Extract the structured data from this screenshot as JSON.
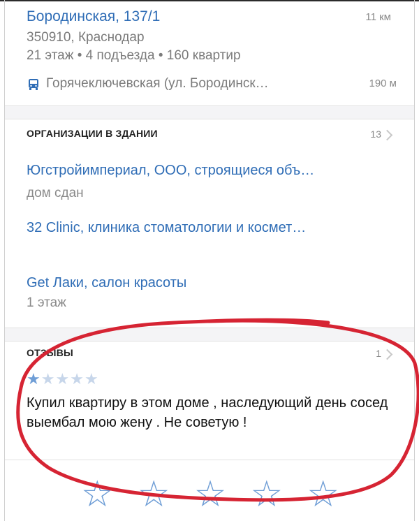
{
  "address": {
    "title": "Бородинская, 137/1",
    "distance": "11 км",
    "postal": "350910, Краснодар",
    "details": "21 этаж • 4 подъезда • 160 квартир",
    "stop": "Горячеключевская (ул. Бородинск…",
    "stop_distance": "190 м",
    "stop_icon": "bus-icon"
  },
  "organizations": {
    "header": "ОРГАНИЗАЦИИ В ЗДАНИИ",
    "count": "13",
    "items": [
      {
        "name": "Югстройимпериал, ООО, строящиеся объ…",
        "sub": "дом сдан"
      },
      {
        "name": "32 Clinic, клиника стоматологии и космет…",
        "sub": ""
      },
      {
        "name": "Get Лаки, салон красоты",
        "sub": "1 этаж"
      }
    ]
  },
  "reviews": {
    "header": "ОТЗЫВЫ",
    "count": "1",
    "rating": 1,
    "rating_max": 5,
    "text": "Купил квартиру в этом доме , наследующий день сосед выембал мою жену . Не советую !"
  },
  "rate_prompt": {
    "stars": 5
  },
  "colors": {
    "link": "#2f6db6",
    "star": "#6f9ed6",
    "annotation": "#d62433"
  }
}
